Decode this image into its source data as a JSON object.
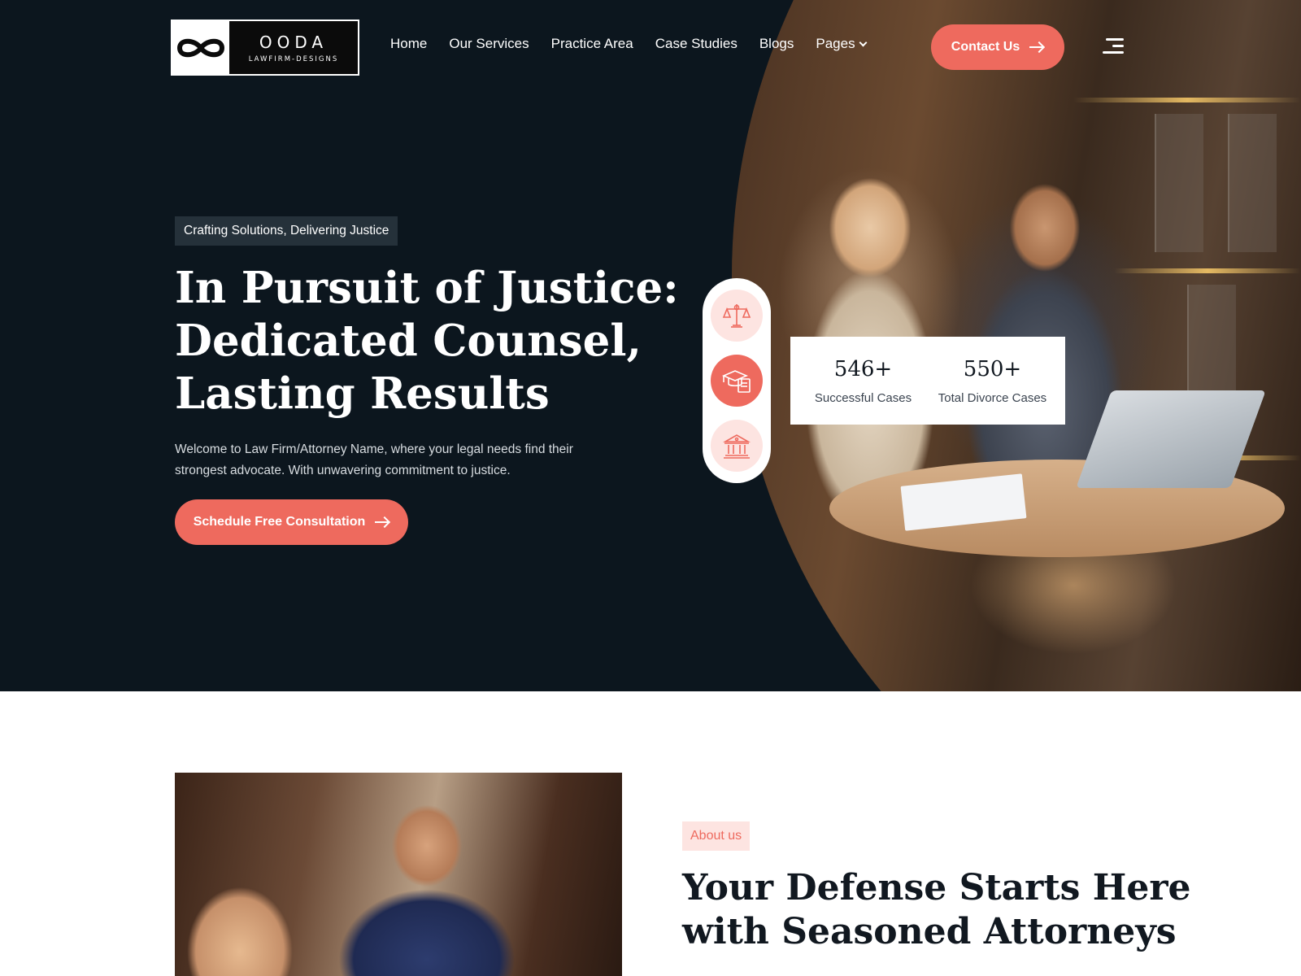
{
  "brand": {
    "name": "OODA",
    "subtitle": "LAWFIRM-DESIGNS",
    "icon": "infinity-icon"
  },
  "nav": {
    "items": [
      {
        "label": "Home"
      },
      {
        "label": "Our Services"
      },
      {
        "label": "Practice Area"
      },
      {
        "label": "Case Studies"
      },
      {
        "label": "Blogs"
      },
      {
        "label": "Pages",
        "has_dropdown": true
      }
    ],
    "contact_label": "Contact Us",
    "menu_icon": "hamburger-menu-icon"
  },
  "hero": {
    "tagline": "Crafting Solutions, Delivering Justice",
    "title_lines": [
      "In Pursuit of Justice:",
      "Dedicated Counsel,",
      "Lasting Results"
    ],
    "description": "Welcome to Law Firm/Attorney Name, where your legal needs find their strongest advocate. With unwavering commitment to justice.",
    "cta_label": "Schedule Free Consultation",
    "icons": [
      "scales-icon",
      "graduation-certificate-icon",
      "courthouse-icon"
    ],
    "stats": [
      {
        "value": "546+",
        "label": "Successful Cases"
      },
      {
        "value": "550+",
        "label": "Total Divorce Cases"
      }
    ]
  },
  "about": {
    "badge": "About us",
    "title_lines": [
      "Your Defense Starts Here",
      "with Seasoned Attorneys"
    ]
  },
  "colors": {
    "accent": "#ee6a5e",
    "accent_light": "#fde4e1",
    "hero_bg": "#0c161e",
    "white": "#ffffff"
  }
}
